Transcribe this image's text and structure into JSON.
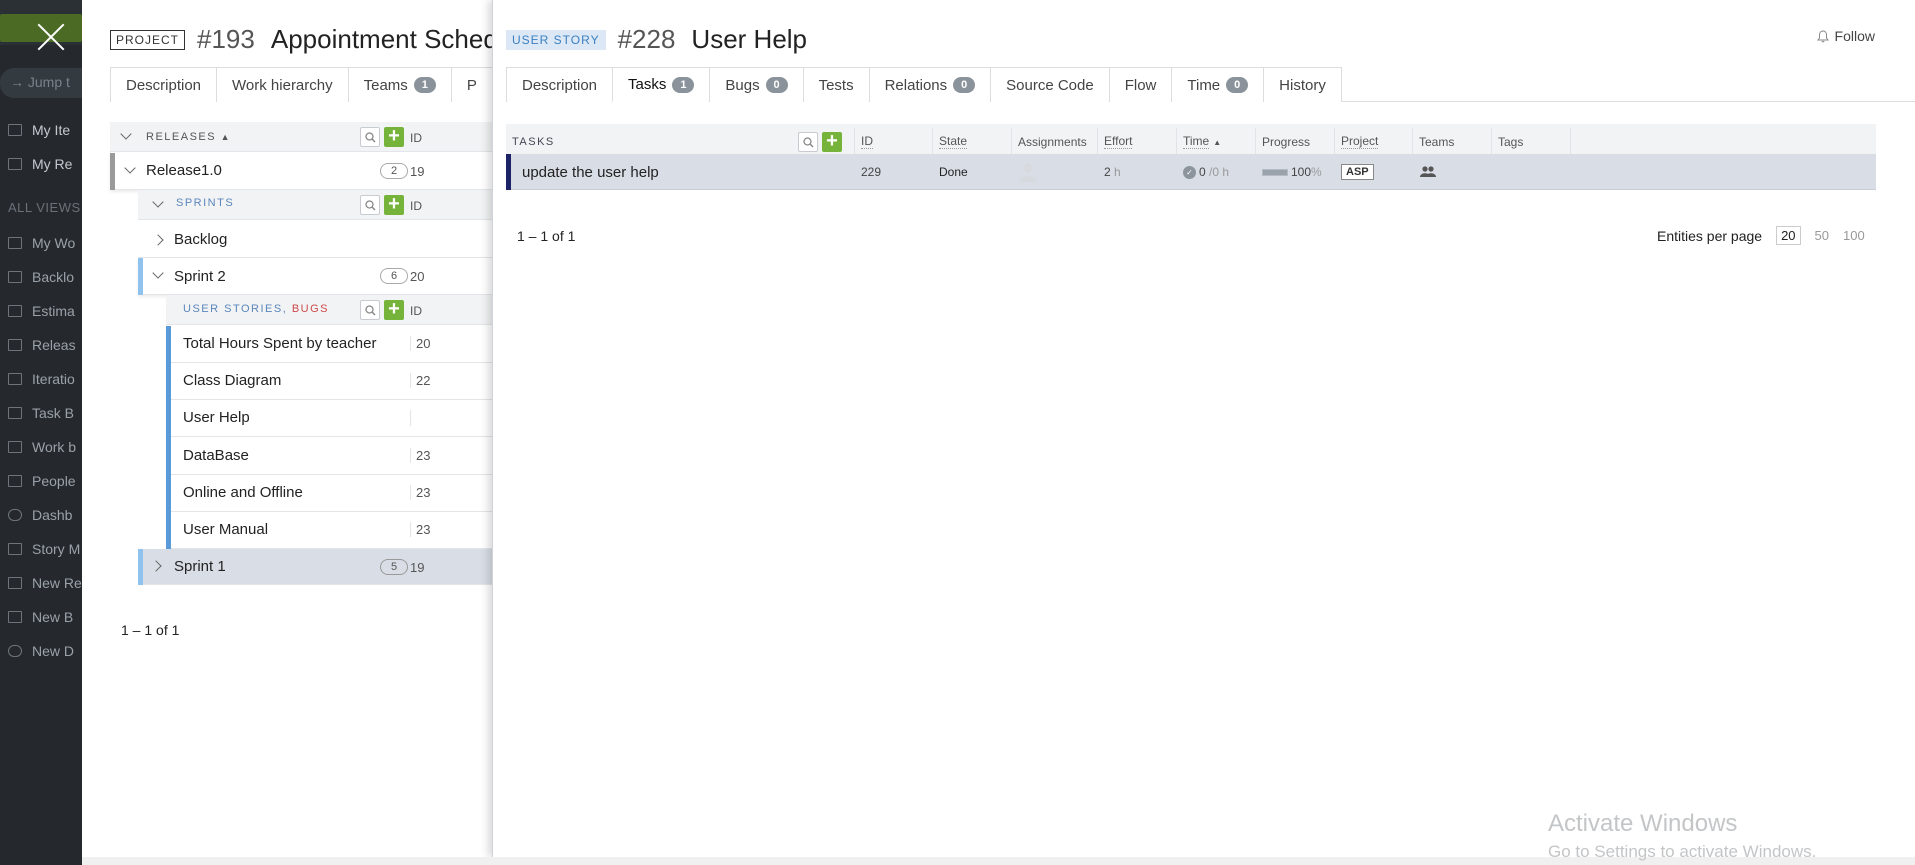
{
  "background_app": {
    "jump_placeholder": "Jump t",
    "items_top": [
      "My Ite",
      "My Re"
    ],
    "all_views_label": "ALL VIEWS",
    "views": [
      "My Wo",
      "Backlo",
      "Estima",
      "Releas",
      "Iteratio",
      "Task B",
      "Work b",
      "People",
      "Dashb",
      "Story M",
      "New Re",
      "New B",
      "New D"
    ]
  },
  "project": {
    "badge": "PROJECT",
    "id": "#193",
    "title": "Appointment Sched",
    "tabs": [
      {
        "label": "Description"
      },
      {
        "label": "Work hierarchy"
      },
      {
        "label": "Teams",
        "count": "1"
      },
      {
        "label": "P"
      }
    ],
    "releases_header": "RELEASES",
    "id_col": "ID",
    "release": {
      "name": "Release1.0",
      "count": "2",
      "id": "19"
    },
    "sprints_header": "SPRINTS",
    "backlog": "Backlog",
    "sprint2": {
      "name": "Sprint 2",
      "count": "6",
      "id": "20"
    },
    "stories_header_a": "USER STORIES",
    "stories_header_sep": ",",
    "stories_header_b": "BUGS",
    "stories": [
      {
        "name": "Total Hours Spent by teacher",
        "id": "20"
      },
      {
        "name": "Class Diagram",
        "id": "22"
      },
      {
        "name": "User Help",
        "id": ""
      },
      {
        "name": "DataBase",
        "id": "23"
      },
      {
        "name": "Online and Offline",
        "id": "23"
      },
      {
        "name": "User Manual",
        "id": "23"
      }
    ],
    "sprint1": {
      "name": "Sprint 1",
      "count": "5",
      "id": "19"
    },
    "pager": "1 – 1 of 1"
  },
  "story": {
    "badge": "USER STORY",
    "id": "#228",
    "title": "User Help",
    "follow": "Follow",
    "tabs": [
      {
        "label": "Description"
      },
      {
        "label": "Tasks",
        "count": "1",
        "active": true
      },
      {
        "label": "Bugs",
        "count": "0"
      },
      {
        "label": "Tests"
      },
      {
        "label": "Relations",
        "count": "0"
      },
      {
        "label": "Source Code"
      },
      {
        "label": "Flow"
      },
      {
        "label": "Time",
        "count": "0"
      },
      {
        "label": "History"
      }
    ],
    "tasks_header": "TASKS",
    "columns": [
      "ID",
      "State",
      "Assignments",
      "Effort",
      "Time",
      "Progress",
      "Project",
      "Teams",
      "Tags"
    ],
    "task": {
      "name": "update the user help",
      "id": "229",
      "state": "Done",
      "effort_value": "2",
      "effort_unit": "h",
      "time_spent": "0",
      "time_rest": "/0 h",
      "progress_value": "100",
      "progress_unit": "%",
      "progress_fraction": 1.0,
      "project": "ASP"
    },
    "pager": "1 – 1 of 1",
    "per_page_label": "Entities per page",
    "per_page_options": [
      "20",
      "50",
      "100"
    ]
  },
  "watermark": {
    "line1": "Activate Windows",
    "line2": "Go to Settings to activate Windows."
  },
  "colors": {
    "accent_green": "#76b33b",
    "selected_row": "#d9dee6",
    "story_badge_bg": "#dce8f5",
    "bug_red": "#cf4a4a"
  }
}
